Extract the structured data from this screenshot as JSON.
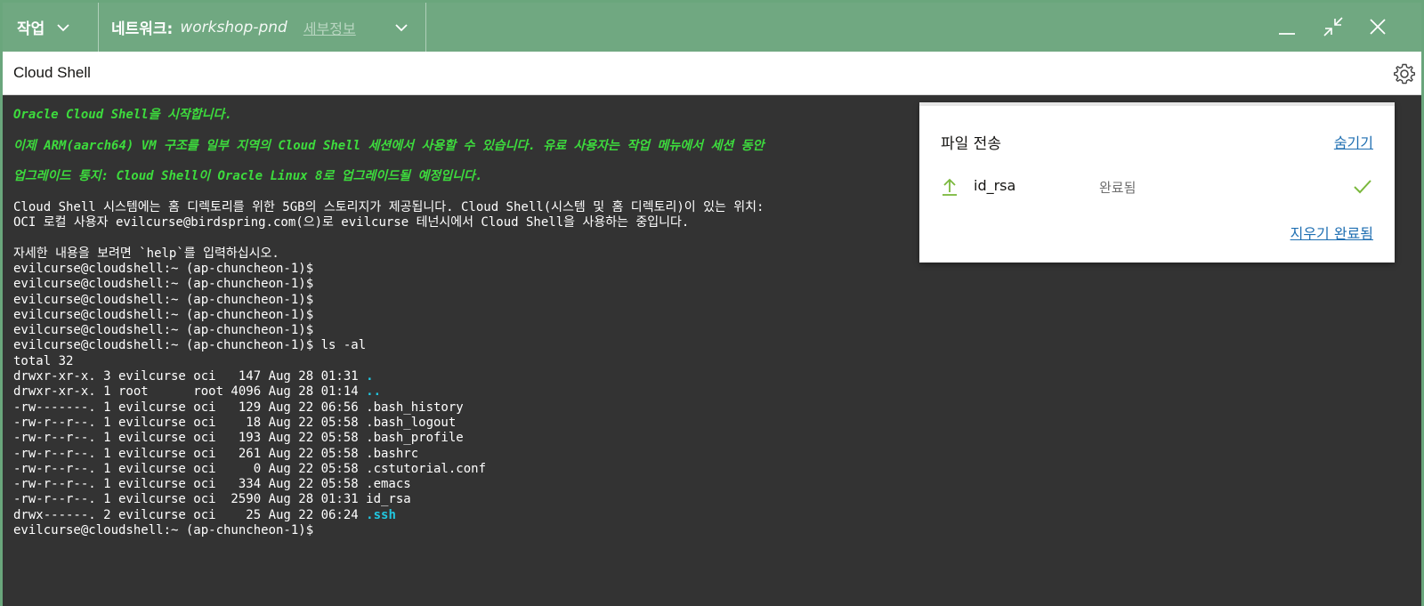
{
  "header": {
    "actions_label": "작업",
    "network_label": "네트워크:",
    "network_name": "workshop-pnd",
    "network_details": "세부정보"
  },
  "window": {
    "title": "Cloud Shell"
  },
  "terminal": {
    "lines": [
      {
        "text": "Oracle Cloud Shell을 시작합니다.",
        "style": "green"
      },
      {
        "text": "",
        "style": "gap"
      },
      {
        "text": "이제 ARM(aarch64) VM 구조를 일부 지역의 Cloud Shell 세션에서 사용할 수 있습니다. 유료 사용자는 작업 메뉴에서 세션 동안",
        "style": "green"
      },
      {
        "text": "",
        "style": "gap"
      },
      {
        "text": "업그레이드 통지: Cloud Shell이 Oracle Linux 8로 업그레이드될 예정입니다.",
        "style": "green"
      },
      {
        "text": "",
        "style": "gap"
      },
      {
        "text": "Cloud Shell 시스템에는 홈 디렉토리를 위한 5GB의 스토리지가 제공됩니다. Cloud Shell(시스템 및 홈 디렉토리)이 있는 위치:",
        "style": "plain"
      },
      {
        "text": "OCI 로컬 사용자 evilcurse@birdspring.com(으)로 evilcurse 테넌시에서 Cloud Shell을 사용하는 중입니다.",
        "style": "plain"
      },
      {
        "text": "",
        "style": "gap"
      },
      {
        "text": "자세한 내용을 보려면 `help`를 입력하십시오.",
        "style": "plain"
      },
      {
        "text": "evilcurse@cloudshell:~ (ap-chuncheon-1)$",
        "style": "plain"
      },
      {
        "text": "evilcurse@cloudshell:~ (ap-chuncheon-1)$",
        "style": "plain"
      },
      {
        "text": "evilcurse@cloudshell:~ (ap-chuncheon-1)$",
        "style": "plain"
      },
      {
        "text": "evilcurse@cloudshell:~ (ap-chuncheon-1)$",
        "style": "plain"
      },
      {
        "text": "evilcurse@cloudshell:~ (ap-chuncheon-1)$",
        "style": "plain"
      },
      {
        "text": "evilcurse@cloudshell:~ (ap-chuncheon-1)$ ls -al",
        "style": "plain"
      },
      {
        "text": "total 32",
        "style": "plain"
      },
      {
        "text": "drwxr-xr-x. 3 evilcurse oci   147 Aug 28 01:31 ",
        "style": "plain",
        "suffix": ".",
        "suffix_style": "cyan"
      },
      {
        "text": "drwxr-xr-x. 1 root      root 4096 Aug 28 01:14 ",
        "style": "plain",
        "suffix": "..",
        "suffix_style": "cyan"
      },
      {
        "text": "-rw-------. 1 evilcurse oci   129 Aug 22 06:56 .bash_history",
        "style": "plain"
      },
      {
        "text": "-rw-r--r--. 1 evilcurse oci    18 Aug 22 05:58 .bash_logout",
        "style": "plain"
      },
      {
        "text": "-rw-r--r--. 1 evilcurse oci   193 Aug 22 05:58 .bash_profile",
        "style": "plain"
      },
      {
        "text": "-rw-r--r--. 1 evilcurse oci   261 Aug 22 05:58 .bashrc",
        "style": "plain"
      },
      {
        "text": "-rw-r--r--. 1 evilcurse oci     0 Aug 22 05:58 .cstutorial.conf",
        "style": "plain"
      },
      {
        "text": "-rw-r--r--. 1 evilcurse oci   334 Aug 22 05:58 .emacs",
        "style": "plain"
      },
      {
        "text": "-rw-r--r--. 1 evilcurse oci  2590 Aug 28 01:31 id_rsa",
        "style": "plain"
      },
      {
        "text": "drwx------. 2 evilcurse oci    25 Aug 22 06:24 ",
        "style": "plain",
        "suffix": ".ssh",
        "suffix_style": "cyan"
      },
      {
        "text": "evilcurse@cloudshell:~ (ap-chuncheon-1)$",
        "style": "plain"
      }
    ]
  },
  "transfer_panel": {
    "title": "파일 전송",
    "hide_label": "숨기기",
    "file_name": "id_rsa",
    "file_status": "완료됨",
    "clear_label": "지우기 완료됨"
  },
  "icons": {
    "actions_chevron": "chevron-down-icon",
    "network_chevron": "chevron-down-icon",
    "minimize": "minimize-icon",
    "restore": "collapse-icon",
    "close": "close-icon",
    "settings": "gear-icon",
    "upload": "upload-arrow-icon",
    "done": "check-icon"
  },
  "colors": {
    "header_green": "#70a881",
    "terminal_bg": "#333333",
    "terminal_green": "#3ddb3d",
    "terminal_cyan": "#21c7e0",
    "link_blue": "#1f6fb2",
    "upload_green": "#7ab83c"
  }
}
